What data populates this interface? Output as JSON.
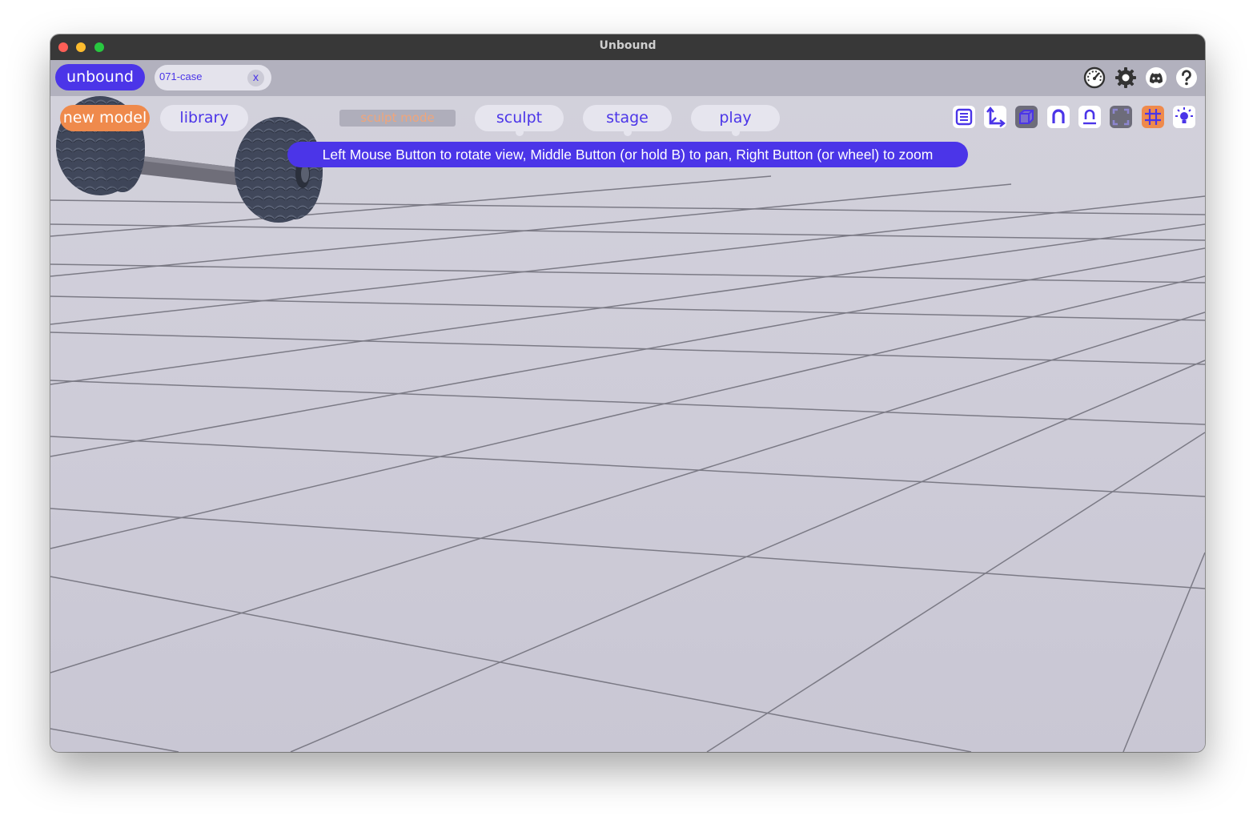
{
  "window": {
    "title": "Unbound"
  },
  "topbar": {
    "brand_label": "unbound",
    "file_tab": {
      "name": "071-case",
      "close_label": "x"
    },
    "icons": [
      "performance-gauge-icon",
      "settings-gear-icon",
      "discord-icon",
      "help-icon"
    ]
  },
  "toolbar": {
    "new_model_label": "new model",
    "library_label": "library",
    "sculpt_mode_label": "sculpt mode",
    "modes": [
      {
        "label": "sculpt"
      },
      {
        "label": "stage"
      },
      {
        "label": "play"
      }
    ],
    "tool_icons": [
      "list-icon",
      "axes-icon",
      "cube-icon",
      "magnet-icon",
      "symmetry-magnet-icon",
      "frame-icon",
      "grid-icon",
      "light-icon"
    ]
  },
  "viewport": {
    "hint": "Left Mouse Button to rotate view, Middle Button (or hold B) to pan, Right Button (or wheel) to zoom",
    "model_name": "071-case"
  },
  "colors": {
    "accent": "#4b35e8",
    "orange": "#ef8a4c",
    "viewport_bg": "#d1cfdc",
    "topbar_bg": "#b2b1be",
    "wheel": "#3f4657",
    "axle": "#6f6e79"
  }
}
